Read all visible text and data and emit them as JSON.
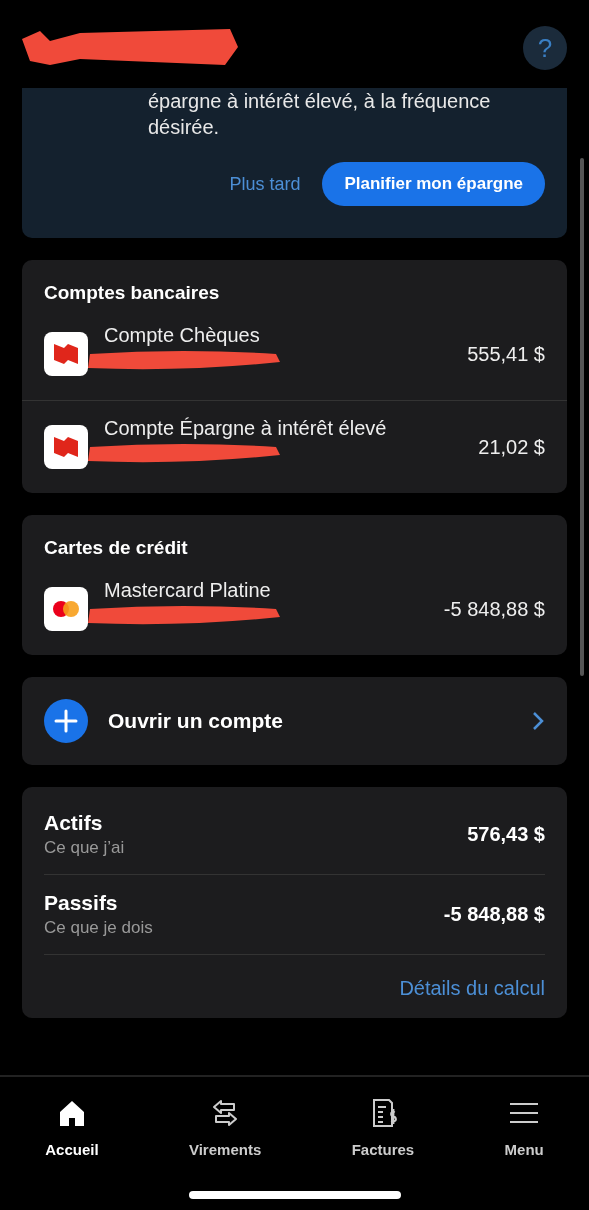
{
  "header": {
    "redacted": true,
    "help": "?"
  },
  "promo": {
    "text": "épargne à intérêt élevé, à la fréquence désirée.",
    "secondary_action": "Plus tard",
    "primary_action": "Planifier mon épargne"
  },
  "sections": [
    {
      "title": "Comptes bancaires",
      "accounts": [
        {
          "kind": "bank",
          "name": "Compte Chèques",
          "balance": "555,41 $",
          "redacted": true
        },
        {
          "kind": "bank",
          "name": "Compte Épargne à intérêt élevé",
          "balance": "21,02 $",
          "redacted": true
        }
      ]
    },
    {
      "title": "Cartes de crédit",
      "accounts": [
        {
          "kind": "card",
          "name": "Mastercard Platine",
          "balance": "-5 848,88 $",
          "redacted": true
        }
      ]
    }
  ],
  "open_account": {
    "label": "Ouvrir un compte"
  },
  "summary": {
    "rows": [
      {
        "title": "Actifs",
        "subtitle": "Ce que j’ai",
        "amount": "576,43 $"
      },
      {
        "title": "Passifs",
        "subtitle": "Ce que je dois",
        "amount": "-5 848,88 $"
      }
    ],
    "link": "Détails du calcul"
  },
  "nav": [
    {
      "kind": "home",
      "label": "Accueil",
      "selected": true
    },
    {
      "kind": "transfer",
      "label": "Virements",
      "selected": false
    },
    {
      "kind": "bills",
      "label": "Factures",
      "selected": false
    },
    {
      "kind": "menu",
      "label": "Menu",
      "selected": false
    }
  ]
}
